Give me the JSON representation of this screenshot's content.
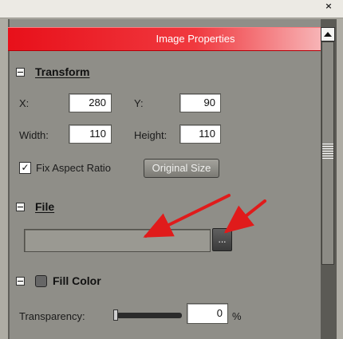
{
  "window": {
    "close_glyph": "×"
  },
  "panel": {
    "title": "Image Properties",
    "header_color": "#e8101a"
  },
  "transform": {
    "section_label": "Transform",
    "x_label": "X:",
    "x_value": "280",
    "y_label": "Y:",
    "y_value": "90",
    "width_label": "Width:",
    "width_value": "110",
    "height_label": "Height:",
    "height_value": "110",
    "fix_aspect_label": "Fix Aspect Ratio",
    "fix_aspect_checked": true,
    "original_size_label": "Original Size"
  },
  "file": {
    "section_label": "File",
    "path_value": "",
    "browse_label": "..."
  },
  "fill_color": {
    "section_label": "Fill Color",
    "transparency_label": "Transparency:",
    "transparency_value": "0",
    "unit": "%"
  },
  "annotations": {
    "arrow_color": "#e01b1b"
  }
}
